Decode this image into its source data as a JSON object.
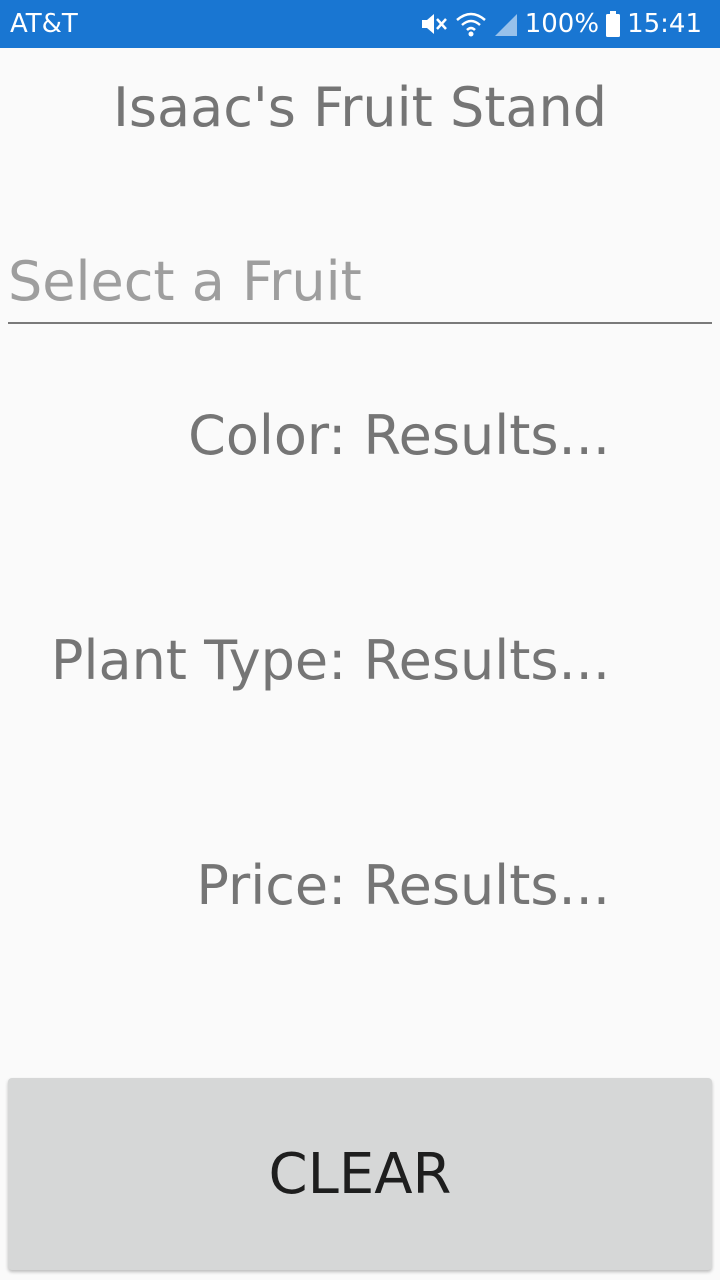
{
  "status_bar": {
    "carrier": "AT&T",
    "battery": "100%",
    "time": "15:41",
    "icons": [
      "mute-icon",
      "wifi-icon",
      "signal-icon",
      "battery-icon"
    ]
  },
  "app": {
    "title": "Isaac's Fruit Stand"
  },
  "fruit_picker": {
    "placeholder": "Select a Fruit"
  },
  "results": {
    "color": "Color: Results...",
    "plant_type": "Plant Type: Results...",
    "price": "Price: Results..."
  },
  "actions": {
    "clear_label": "CLEAR"
  },
  "colors": {
    "status_bar": "#1976d2",
    "background": "#fafafa",
    "text": "#757575",
    "placeholder": "#9e9e9e",
    "button": "#d6d7d7"
  }
}
